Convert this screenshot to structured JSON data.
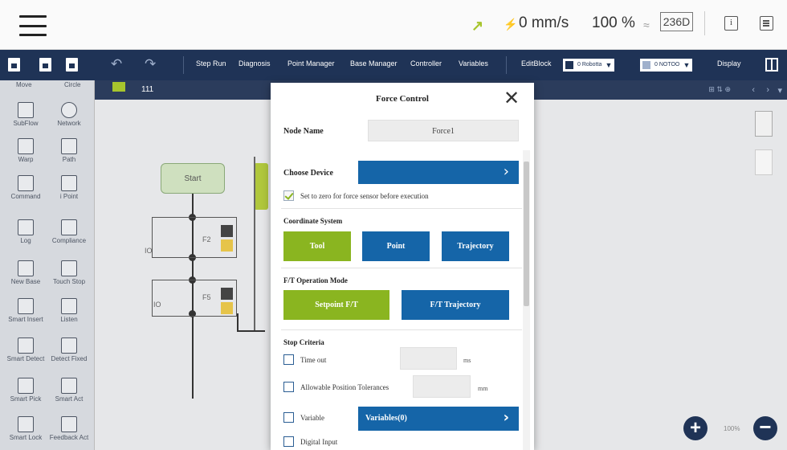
{
  "status": {
    "speed": "0 mm/s",
    "percent": "100 %",
    "badge": "236D",
    "info_glyph": "i"
  },
  "toolbar": {
    "items": [
      "Step Run",
      "Diagnosis",
      "Point Manager",
      "Base Manager",
      "Controller",
      "Variables"
    ],
    "editblock": "EditBlock",
    "robot_dd": "0 Robotta",
    "tool_dd": "0 NOTOO",
    "display": "Display"
  },
  "palette": {
    "top_left": "Move",
    "top_right": "Circle",
    "items": [
      {
        "label": "SubFlow",
        "icon": "subflow-icon"
      },
      {
        "label": "Network",
        "icon": "globe-icon"
      },
      {
        "label": "Warp",
        "icon": "warp-icon"
      },
      {
        "label": "Path",
        "icon": "path-icon"
      },
      {
        "label": "Command",
        "icon": "command-icon"
      },
      {
        "label": "i Point",
        "icon": "point-icon"
      },
      {
        "label": "Log",
        "icon": "log-icon"
      },
      {
        "label": "Compliance",
        "icon": "compliance-icon"
      },
      {
        "label": "New Base",
        "icon": "new-base-icon"
      },
      {
        "label": "Touch Stop",
        "icon": "touch-stop-icon"
      },
      {
        "label": "Smart Insert",
        "icon": "smart-insert-icon"
      },
      {
        "label": "Listen",
        "icon": "listen-icon"
      },
      {
        "label": "Smart Detect",
        "icon": "smart-detect-icon"
      },
      {
        "label": "Detect Fixed",
        "icon": "detect-fixed-icon"
      },
      {
        "label": "Smart Pick",
        "icon": "smart-pick-icon"
      },
      {
        "label": "Smart Act",
        "icon": "smart-act-icon"
      },
      {
        "label": "Smart Lock",
        "icon": "smart-lock-icon"
      },
      {
        "label": "Feedback Act",
        "icon": "feedback-icon"
      }
    ]
  },
  "canvas": {
    "tab_label": "111",
    "start_label": "Start",
    "flow_label_1": "F2",
    "flow_label_2": "F5",
    "flow_code_1": "IO",
    "flow_code_2": "IO",
    "zoom": "100%"
  },
  "dialog": {
    "title": "Force Control",
    "node_name_label": "Node Name",
    "node_name_value": "Force1",
    "choose_device_label": "Choose Device",
    "zero_sensor_text": "Set to zero for force sensor before execution",
    "zero_sensor_checked": true,
    "coordinate_label": "Coordinate System",
    "coordinate_options": [
      "Tool",
      "Point",
      "Trajectory"
    ],
    "coordinate_selected": "Tool",
    "ft_mode_label": "F/T Operation Mode",
    "ft_mode_options": [
      "Setpoint F/T",
      "F/T Trajectory"
    ],
    "ft_mode_selected": "Setpoint F/T",
    "stop_criteria_label": "Stop Criteria",
    "timeout_text": "Time out",
    "timeout_unit": "ms",
    "tolerance_text": "Allowable Position Tolerances",
    "tolerance_unit": "mm",
    "variable_text": "Variable",
    "variable_button": "Variables(0)",
    "digital_input_text": "Digital Input"
  },
  "colors": {
    "navy": "#1f3356",
    "green": "#8ab520",
    "blue": "#1565a8"
  }
}
